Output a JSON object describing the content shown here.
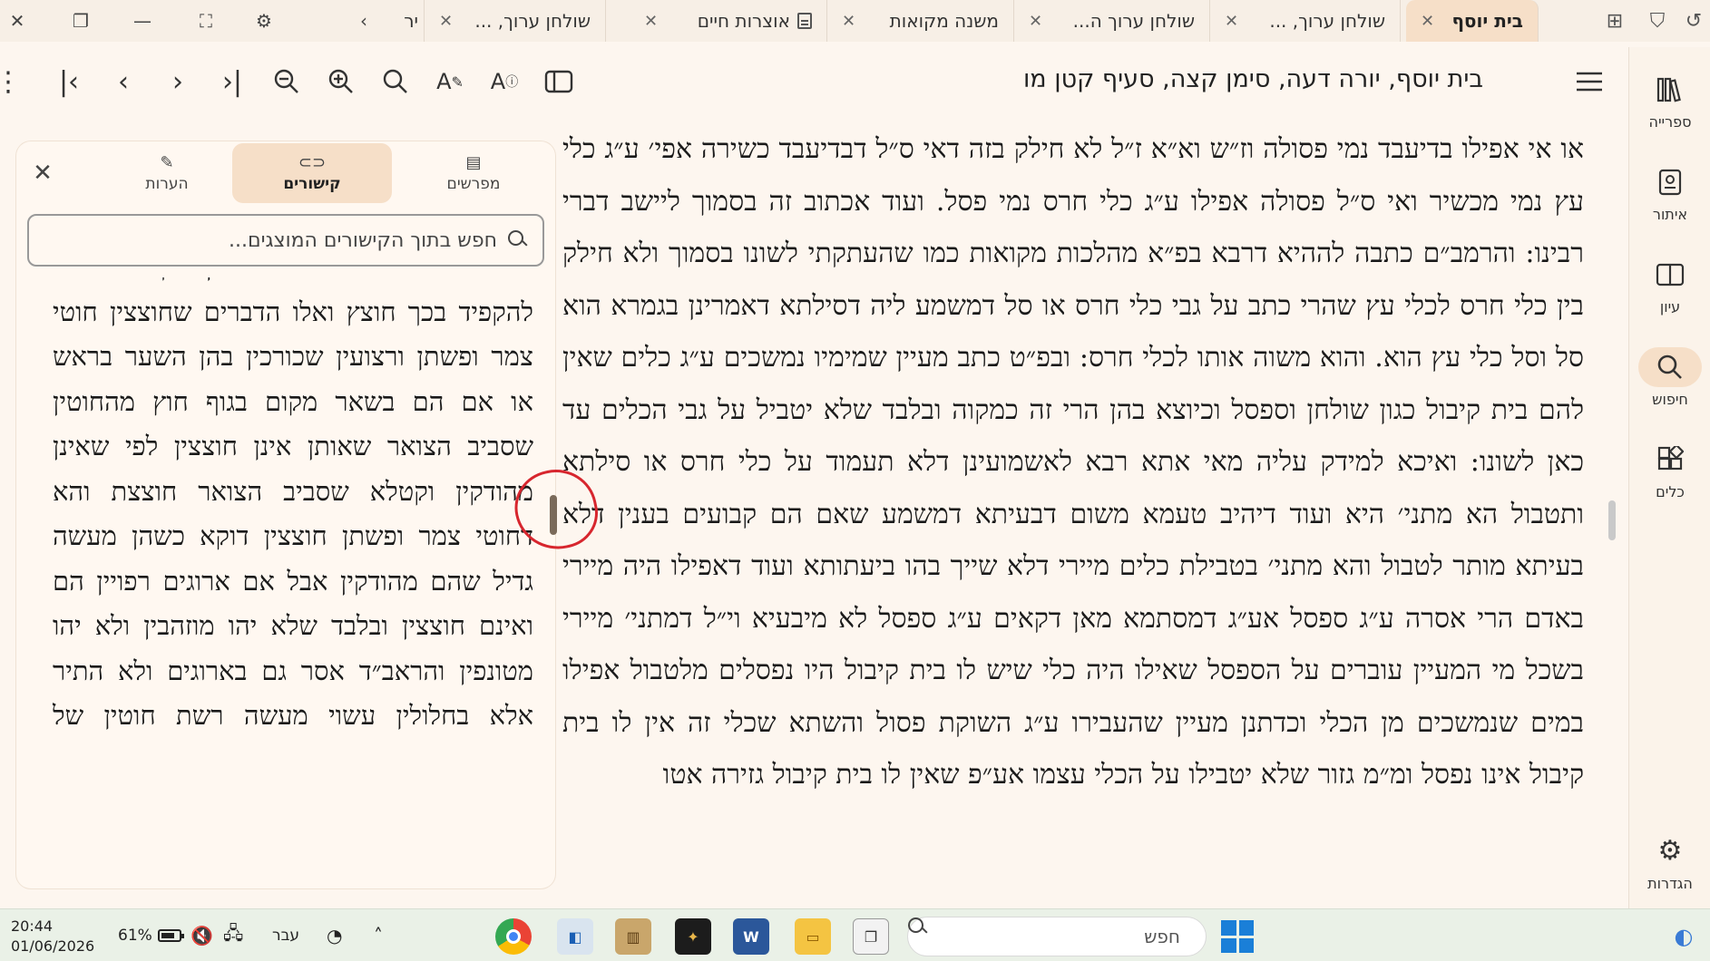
{
  "tabs": [
    {
      "title": "בית יוסף",
      "active": true
    },
    {
      "title": "שולחן ערוך, ..."
    },
    {
      "title": "שולחן ערוך ה..."
    },
    {
      "title": "משנה מקואות"
    },
    {
      "title": "אוצרות חיים"
    },
    {
      "title": "שולחן ערוך, ..."
    },
    {
      "title": "יר"
    }
  ],
  "toolbar": {
    "breadcrumb": "בית יוסף, יורה דעה, סימן קצה, סעיף קטן מו"
  },
  "sidenav": {
    "items": [
      {
        "label": "ספרייה",
        "icon": "library-icon"
      },
      {
        "label": "איתור",
        "icon": "locate-icon"
      },
      {
        "label": "עיון",
        "icon": "study-icon"
      },
      {
        "label": "חיפוש",
        "icon": "search-icon",
        "active": true
      },
      {
        "label": "כלים",
        "icon": "tools-icon"
      }
    ],
    "settings_label": "הגדרות"
  },
  "main_text": "או אי אפילו בדיעבד נמי פסולה וז״ש וא״א ז״ל לא חילק בזה דאי ס״ל דבדיעבד כשירה אפי׳ ע״ג כלי עץ נמי מכשיר ואי ס״ל פסולה אפילו ע״ג כלי חרס נמי פסל. ועוד אכתוב זה בסמוך ליישב דברי רבינו: והרמב״ם כתבה לההיא דרבא בפ״א מהלכות מקואות כמו שהעתקתי לשונו בסמוך ולא חילק בין כלי חרס לכלי עץ שהרי כתב על גבי כלי חרס או סל דמשמע ליה דסילתא דאמרינן בגמרא הוא סל וסל כלי עץ הוא. והוא משוה אותו לכלי חרס: ובפ״ט כתב מעיין שמימיו נמשכים ע״ג כלים שאין להם בית קיבול כגון שולחן וספסל וכיוצא בהן הרי זה כמקוה ובלבד שלא יטביל על גבי הכלים עד כאן לשונו: ואיכא למידק עליה מאי אתא רבא לאשמועינן דלא תעמוד על כלי חרס או סילתא ותטבול הא מתני׳ היא ועוד דיהיב טעמא משום דבעיתא דמשמע שאם הם קבועים בענין דלא בעיתא מותר לטבול והא מתני׳ בטבילת כלים מיירי דלא שייך בהו ביעתותא ועוד דאפילו היה מיירי באדם הרי אסרה ע״ג ספסל אע״ג דמסתמא מאן דקאים ע״ג ספסל לא מיבעיא וי״ל דמתני׳ מיירי בשכל מי המעיין עוברים על הספסל שאילו היה כלי שיש לו בית קיבול היו נפסלים מלטבול אפילו במים שנמשכים מן הכלי וכדתנן מעיין שהעבירו ע״ג השוקת פסול והשתא שכלי זה אין לו בית קיבול אינו נפסל ומ״מ גזור שלא יטבילו על הכלי עצמו אע״פ שאין לו בית קיבול גזירה אטו",
  "panel": {
    "tabs": [
      {
        "label": "מפרשים",
        "icon": "commentary-icon"
      },
      {
        "label": "קישורים",
        "icon": "link-icon",
        "active": true
      },
      {
        "label": "הערות",
        "icon": "notes-icon"
      }
    ],
    "search_placeholder": "חפש בתוך הקישורים המוצגים...",
    "text": "הוא הומה דרב הגוני אפילו אין דרך בני אדם להקפיד בכך חוצץ ואלו הדברים שחוצצין חוטי צמר ופשתן ורצועין שכורכין בהן השער בראש או אם הם בשאר מקום בגוף חוץ מהחוטין שסביב הצואר שאותן אינן חוצצין לפי שאינן מהודקין וקטלא שסביב הצואר חוצצת והא דחוטי צמר ופשתן חוצצין דוקא כשהן מעשה גדיל שהם מהודקין אבל אם ארוגים רפויין הם ואינם חוצצין ובלבד שלא יהו מוזהבין ולא יהו מטונפין והראב״ד אסר גם בארוגים ולא התיר אלא בחלולין עשוי מעשה רשת חוטין של"
  },
  "taskbar": {
    "time": "20:44",
    "date": "01/06/2026",
    "battery": "61%",
    "language": "עבר",
    "search_placeholder": "חפש"
  }
}
